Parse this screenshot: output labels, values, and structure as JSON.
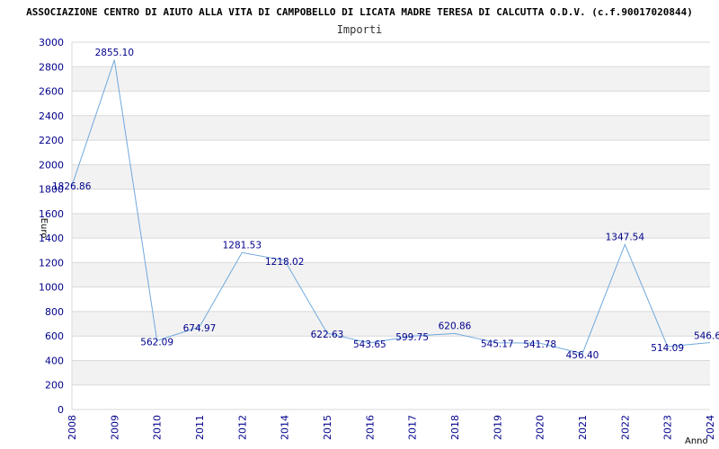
{
  "chart_data": {
    "type": "line",
    "title": "ASSOCIAZIONE CENTRO DI AIUTO ALLA VITA DI CAMPOBELLO DI LICATA MADRE TERESA DI CALCUTTA O.D.V. (c.f.90017020844)",
    "subtitle": "Importi",
    "xlabel": "Anno",
    "ylabel": "Euro",
    "ylim": [
      0,
      3000
    ],
    "yticks": [
      "0",
      "200",
      "400",
      "600",
      "800",
      "1000",
      "1200",
      "1400",
      "1600",
      "1800",
      "2000",
      "2200",
      "2400",
      "2600",
      "2800",
      "3000"
    ],
    "categories": [
      "2008",
      "2009",
      "2010",
      "2011",
      "2012",
      "2014",
      "2015",
      "2016",
      "2017",
      "2018",
      "2019",
      "2020",
      "2021",
      "2022",
      "2023",
      "2024"
    ],
    "values": [
      1826.86,
      2855.1,
      562.09,
      674.97,
      1281.53,
      1218.02,
      622.63,
      543.65,
      599.75,
      620.86,
      545.17,
      541.78,
      456.4,
      1347.54,
      514.09,
      546.6
    ],
    "data_labels": [
      "1826.86",
      "2855.10",
      "562.09",
      "674.97",
      "1281.53",
      "1218.02",
      "622.63",
      "543.65",
      "599.75",
      "620.86",
      "545.17",
      "541.78",
      "456.40",
      "1347.54",
      "514.09",
      "546.6"
    ],
    "grid": true,
    "legend": "none",
    "colors": {
      "line": "#6fa8dc",
      "label": "#00008b",
      "band": "#f2f2f2",
      "grid": "#d9d9d9",
      "title": "#000000"
    }
  }
}
